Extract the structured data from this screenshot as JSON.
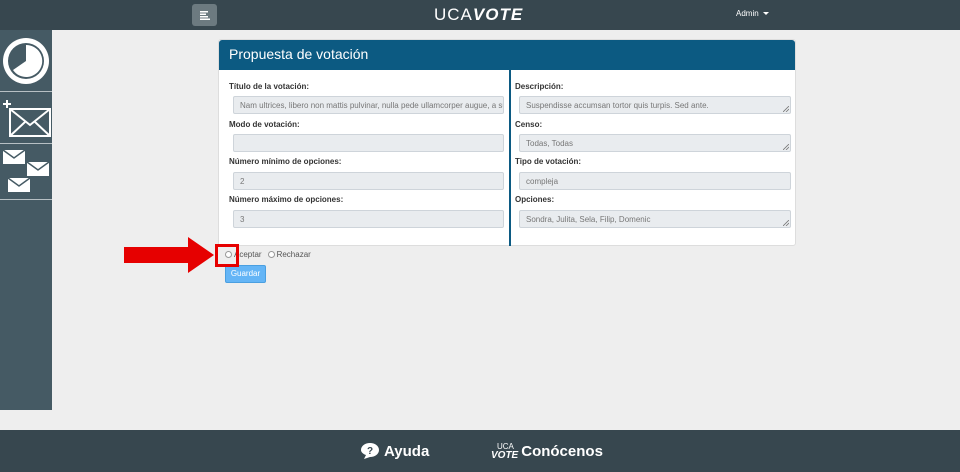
{
  "topbar": {
    "brand_prefix": "UCA",
    "brand_suffix": "VOTE",
    "user_menu": "Admin"
  },
  "sidebar": {
    "items": [
      {
        "icon": "pie-chart-icon"
      },
      {
        "icon": "new-message-icon"
      },
      {
        "icon": "messages-icon"
      }
    ]
  },
  "card": {
    "title": "Propuesta de votación",
    "left": {
      "titulo_label": "Título de la votación:",
      "titulo_value": "Nam ultrices, libero non mattis pulvinar, nulla pede ullamcorper augue, a susc",
      "modo_label": "Modo de votación:",
      "modo_value": "",
      "min_label": "Número mínimo de opciones:",
      "min_value": "2",
      "max_label": "Número máximo de opciones:",
      "max_value": "3"
    },
    "right": {
      "descripcion_label": "Descripción:",
      "descripcion_value": "Suspendisse accumsan tortor quis turpis. Sed ante.",
      "censo_label": "Censo:",
      "censo_value": "Todas, Todas",
      "tipo_label": "Tipo de votación:",
      "tipo_value": "compleja",
      "opciones_label": "Opciones:",
      "opciones_value": "Sondra, Julita, Sela, Filip, Domenic"
    }
  },
  "form": {
    "accept_label": "Aceptar",
    "reject_label": "Rechazar",
    "save_label": "Guardar"
  },
  "footer": {
    "help_label": "Ayuda",
    "about_label": "Conócenos",
    "about_logo_top": "UCA",
    "about_logo_bottom": "VOTE"
  },
  "colors": {
    "topbar": "#37474f",
    "sidebar": "#455a64",
    "card_header": "#0c5a82",
    "save_button": "#64b5f6",
    "annotation": "#e60000"
  }
}
